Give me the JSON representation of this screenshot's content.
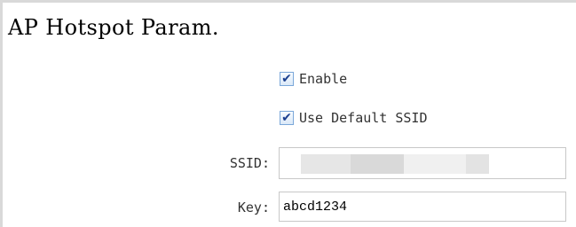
{
  "panel": {
    "title": "AP Hotspot Param."
  },
  "checkboxes": {
    "enable": {
      "label": "Enable",
      "checked": true,
      "icon": "checkmark-icon"
    },
    "use_default_ssid": {
      "label": "Use Default SSID",
      "checked": true,
      "icon": "checkmark-icon"
    }
  },
  "fields": {
    "ssid": {
      "label": "SSID:",
      "value": "",
      "redacted": true
    },
    "key": {
      "label": "Key:",
      "value": "abcd1234"
    }
  },
  "colors": {
    "frame_border": "#d9d9d9",
    "input_border": "#c8c8c8",
    "checkbox_border": "#7aa7d9",
    "checkmark": "#1b3f8f",
    "label_text": "#333333"
  }
}
